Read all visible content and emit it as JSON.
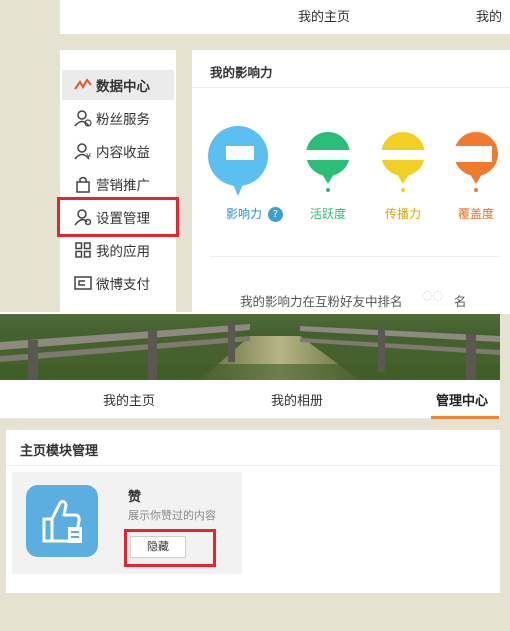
{
  "top": {
    "header_tabs": [
      "我的主页",
      "我的"
    ],
    "sidebar": [
      {
        "label": "数据中心",
        "icon": "trend-icon"
      },
      {
        "label": "粉丝服务",
        "icon": "fans-icon"
      },
      {
        "label": "内容收益",
        "icon": "income-icon"
      },
      {
        "label": "营销推广",
        "icon": "bag-icon"
      },
      {
        "label": "设置管理",
        "icon": "user-settings-icon"
      },
      {
        "label": "我的应用",
        "icon": "apps-icon"
      },
      {
        "label": "微博支付",
        "icon": "payment-icon"
      }
    ],
    "panel": {
      "title": "我的影响力",
      "metrics": [
        {
          "label": "影响力",
          "color": "#5bc0f0"
        },
        {
          "label": "活跃度",
          "color": "#2bbd7a"
        },
        {
          "label": "传播力",
          "color": "#f2cf25"
        },
        {
          "label": "覆盖度",
          "color": "#f07a2e"
        }
      ],
      "help_symbol": "?",
      "rank_text": "我的影响力在互粉好友中排名",
      "rank_suffix": "名"
    }
  },
  "bottom": {
    "nav_tabs": [
      "我的主页",
      "我的相册",
      "管理中心"
    ],
    "module_title": "主页模块管理",
    "module": {
      "name": "赞",
      "desc": "展示你赞过的内容",
      "button": "隐藏"
    }
  },
  "colors": {
    "highlight": "#e3262f",
    "tab_underline": "#f58332",
    "page_bg": "#e5e2d1"
  }
}
